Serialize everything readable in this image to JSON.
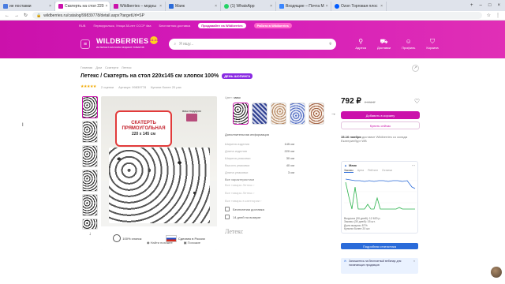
{
  "browser": {
    "tabs": [
      {
        "label": "ие поставки",
        "color": "#4a7de0",
        "active": false
      },
      {
        "label": "Скатерть на стол 220",
        "color": "#cb11ab",
        "active": true
      },
      {
        "label": "Wildberries – модны",
        "color": "#cb11ab",
        "active": false
      },
      {
        "label": "Маяк",
        "color": "#2a6bd9",
        "active": false
      },
      {
        "label": "(1) WhatsApp",
        "color": "#25d366",
        "active": false
      },
      {
        "label": "Входящие – Почта М",
        "color": "#3a86ff",
        "active": false
      },
      {
        "label": "Ozon Торговая плос",
        "color": "#005bff",
        "active": false
      }
    ],
    "url": "wildberries.ru/catalog/99839778/detail.aspx?targetUrl=SP"
  },
  "header": {
    "region": "RUB",
    "address": "Первоуральск, Улица 38-лет СССР 4ва",
    "sell_link": "Бесплатная доставка",
    "promo1": "Продавайте на Wildberries",
    "promo2": "Работа в Wildberries",
    "logo": "WILDBERRIES",
    "logo_sub": "ИНТЕРНЕТ-МАГАЗИН МОДНЫХ ТОВАРОВ",
    "logo_badge": "11.11",
    "search_placeholder": "Я ищу...",
    "icons": [
      {
        "label": "Адреса",
        "icon": "location-icon"
      },
      {
        "label": "Доставки",
        "icon": "delivery-icon"
      },
      {
        "label": "Профиль",
        "icon": "profile-icon"
      },
      {
        "label": "Корзина",
        "icon": "cart-icon"
      }
    ]
  },
  "breadcrumb": [
    "Главная",
    "Дом",
    "Скатерти",
    "Летекс"
  ],
  "product": {
    "title": "Летекс / Скатерть на стол 220х145 см хлопок 100%",
    "badge": "ДЕНЬ ШОПИНГА",
    "stars": "★★★★★",
    "reviews": "2 оценки",
    "article": "Артикул: 99839778",
    "bought": "Купили более 20 раз",
    "sign_line1": "СКАТЕРТЬ",
    "sign_line2": "ПРЯМОУГОЛЬНАЯ",
    "sign_size": "220 х 145 см",
    "gift_label": "ваш подарок",
    "cotton": "100% хлопок",
    "made_in": "Сделано в России",
    "find_similar": "Найти похожее",
    "similar": "Похожие"
  },
  "variants": {
    "color_label": "Цвет:",
    "color_value": "микс"
  },
  "info": {
    "heading": "Дополнительная информация",
    "specs": [
      {
        "k": "Ширина изделия",
        "v": "145 см"
      },
      {
        "k": "Длина изделия",
        "v": "220 см"
      },
      {
        "k": "Ширина упаковки",
        "v": "30 см"
      },
      {
        "k": "Высота упаковки",
        "v": "40 см"
      },
      {
        "k": "Длина упаковки",
        "v": "3 см"
      }
    ],
    "all_specs": "Все характеристики",
    "links": [
      "Все товары Летекс ›",
      "Все товары Летекс ›",
      "Все товары в категории ›"
    ],
    "features": [
      "Бесплатная доставка",
      "14 дней на возврат"
    ],
    "brand": "Летекс"
  },
  "price": {
    "current": "792 ₽",
    "old": "2 938 ₽",
    "add_to_cart": "Добавить в корзину",
    "buy_now": "Купить сейчас",
    "delivery_date": "15-16 ноября",
    "delivery_text": "доставит Wildberries со склада Екатеринбург WB"
  },
  "mayak": {
    "title": "Маяк",
    "tabs": [
      "Заказы",
      "Цена",
      "Рейтинг",
      "Остатки"
    ],
    "stats": [
      "Выручка (30 дней): 12 620 р.",
      "Заказы (30 дней): 15 шт.",
      "Доля выкупа: 87%",
      "Купили более 20 шт."
    ],
    "detail_btn": "Подробная статистика",
    "notice": "Запишитесь на бесплатный вебинар для начинающих продавцов"
  },
  "colors": {
    "brand": "#cb11ab",
    "mayak_blue": "#2a6bd9",
    "chart_green": "#2bb24c"
  }
}
